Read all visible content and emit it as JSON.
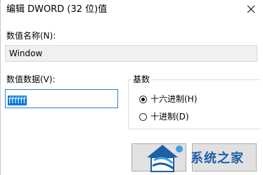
{
  "window": {
    "title": "编辑 DWORD (32 位)值",
    "close_icon": "close-icon"
  },
  "value_name": {
    "label": "数值名称(N):",
    "value": "Window"
  },
  "value_data": {
    "label": "数值数据(V):",
    "value": "ffffff"
  },
  "radix": {
    "legend": "基数",
    "options": [
      {
        "label": "十六进制(H)",
        "checked": true
      },
      {
        "label": "十进制(D)",
        "checked": false
      }
    ]
  },
  "watermark": {
    "text": "系统之家",
    "logo_icon": "house-logo-icon"
  },
  "colors": {
    "selection": "#0078d7",
    "focus_border": "#2a7fd6",
    "watermark": "#1e5fa6"
  }
}
